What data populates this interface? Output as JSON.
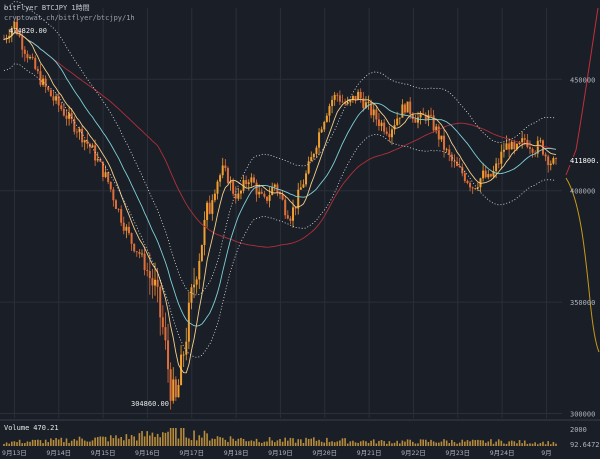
{
  "header": {
    "title": "bitFlyer BTCJPY 1時間",
    "source": "cryptowat.ch/bitflyer/btcjpy/1h"
  },
  "colors": {
    "background": "#1a1e27",
    "grid": "#2a2f3a",
    "up": "#f0a030",
    "down": "#e0703a",
    "ma_fast": "#f4d08a",
    "ma_mid": "#7ecfd6",
    "ma_slow": "#b0303a",
    "band": "#e8e8e8",
    "depth_bid": "#c79a1a",
    "depth_ask": "#c0303a",
    "volume": "#d4a040"
  },
  "chart_data": {
    "type": "candlestick",
    "timeframe": "1h",
    "x_categories": [
      "9月13日",
      "9月14日",
      "9月15日",
      "9月16日",
      "9月17日",
      "9月18日",
      "9月19日",
      "9月20日",
      "9月21日",
      "9月22日",
      "9月23日",
      "9月24日",
      "9月"
    ],
    "yticks": [
      300000,
      350000,
      400000,
      450000
    ],
    "ylim": [
      298000,
      482000
    ],
    "annotations": {
      "high": "474820.00",
      "low": "304860.00",
      "last": "411800.00"
    },
    "volume": {
      "label": "Volume",
      "value": "470.21",
      "yticks": [
        "2000",
        "92.6472"
      ]
    },
    "price_path": [
      [
        0,
        468000
      ],
      [
        2,
        472000
      ],
      [
        4,
        474820
      ],
      [
        7,
        466000
      ],
      [
        10,
        459000
      ],
      [
        13,
        452000
      ],
      [
        16,
        446000
      ],
      [
        19,
        441000
      ],
      [
        22,
        437000
      ],
      [
        25,
        432000
      ],
      [
        28,
        428000
      ],
      [
        31,
        423000
      ],
      [
        34,
        418000
      ],
      [
        37,
        411000
      ],
      [
        40,
        404000
      ],
      [
        43,
        394000
      ],
      [
        46,
        385000
      ],
      [
        49,
        377000
      ],
      [
        52,
        372000
      ],
      [
        55,
        364000
      ],
      [
        58,
        356000
      ],
      [
        61,
        338000
      ],
      [
        64,
        312000
      ],
      [
        66,
        304860
      ],
      [
        68,
        320000
      ],
      [
        70,
        336000
      ],
      [
        72,
        352000
      ],
      [
        74,
        366000
      ],
      [
        76,
        378000
      ],
      [
        78,
        389000
      ],
      [
        80,
        398000
      ],
      [
        82,
        405000
      ],
      [
        84,
        409000
      ],
      [
        86,
        406000
      ],
      [
        88,
        400000
      ],
      [
        90,
        397000
      ],
      [
        92,
        402000
      ],
      [
        94,
        406000
      ],
      [
        96,
        403000
      ],
      [
        98,
        398000
      ],
      [
        100,
        395000
      ],
      [
        102,
        399000
      ],
      [
        104,
        403000
      ],
      [
        106,
        398000
      ],
      [
        108,
        392000
      ],
      [
        110,
        389000
      ],
      [
        112,
        394000
      ],
      [
        114,
        401000
      ],
      [
        116,
        407000
      ],
      [
        118,
        414000
      ],
      [
        120,
        422000
      ],
      [
        122,
        430000
      ],
      [
        124,
        436000
      ],
      [
        126,
        441000
      ],
      [
        128,
        443000
      ],
      [
        130,
        440000
      ],
      [
        132,
        438000
      ],
      [
        134,
        441000
      ],
      [
        136,
        443000
      ],
      [
        138,
        440000
      ],
      [
        140,
        437000
      ],
      [
        142,
        434000
      ],
      [
        144,
        431000
      ],
      [
        146,
        429000
      ],
      [
        148,
        427000
      ],
      [
        150,
        431000
      ],
      [
        152,
        435000
      ],
      [
        154,
        438000
      ],
      [
        156,
        436000
      ],
      [
        158,
        433000
      ],
      [
        160,
        432000
      ],
      [
        162,
        434000
      ],
      [
        164,
        431000
      ],
      [
        166,
        427000
      ],
      [
        168,
        422000
      ],
      [
        170,
        417000
      ],
      [
        172,
        413000
      ],
      [
        174,
        410000
      ],
      [
        176,
        408000
      ],
      [
        178,
        405000
      ],
      [
        180,
        402000
      ],
      [
        182,
        404000
      ],
      [
        184,
        407000
      ],
      [
        186,
        405000
      ],
      [
        188,
        408000
      ],
      [
        190,
        413000
      ],
      [
        192,
        419000
      ],
      [
        194,
        421000
      ],
      [
        196,
        417000
      ],
      [
        198,
        420000
      ],
      [
        200,
        423000
      ],
      [
        202,
        421000
      ],
      [
        204,
        419000
      ],
      [
        206,
        421000
      ],
      [
        208,
        416000
      ],
      [
        210,
        413000
      ],
      [
        212,
        411800
      ]
    ],
    "volume_path": [
      [
        0,
        0.25
      ],
      [
        10,
        0.3
      ],
      [
        20,
        0.35
      ],
      [
        30,
        0.45
      ],
      [
        40,
        0.5
      ],
      [
        50,
        0.6
      ],
      [
        58,
        0.8
      ],
      [
        62,
        0.95
      ],
      [
        66,
        1.0
      ],
      [
        70,
        0.85
      ],
      [
        80,
        0.6
      ],
      [
        90,
        0.45
      ],
      [
        100,
        0.4
      ],
      [
        110,
        0.35
      ],
      [
        120,
        0.4
      ],
      [
        130,
        0.35
      ],
      [
        140,
        0.3
      ],
      [
        150,
        0.28
      ],
      [
        160,
        0.3
      ],
      [
        170,
        0.32
      ],
      [
        180,
        0.28
      ],
      [
        190,
        0.3
      ],
      [
        200,
        0.25
      ],
      [
        212,
        0.22
      ]
    ]
  }
}
